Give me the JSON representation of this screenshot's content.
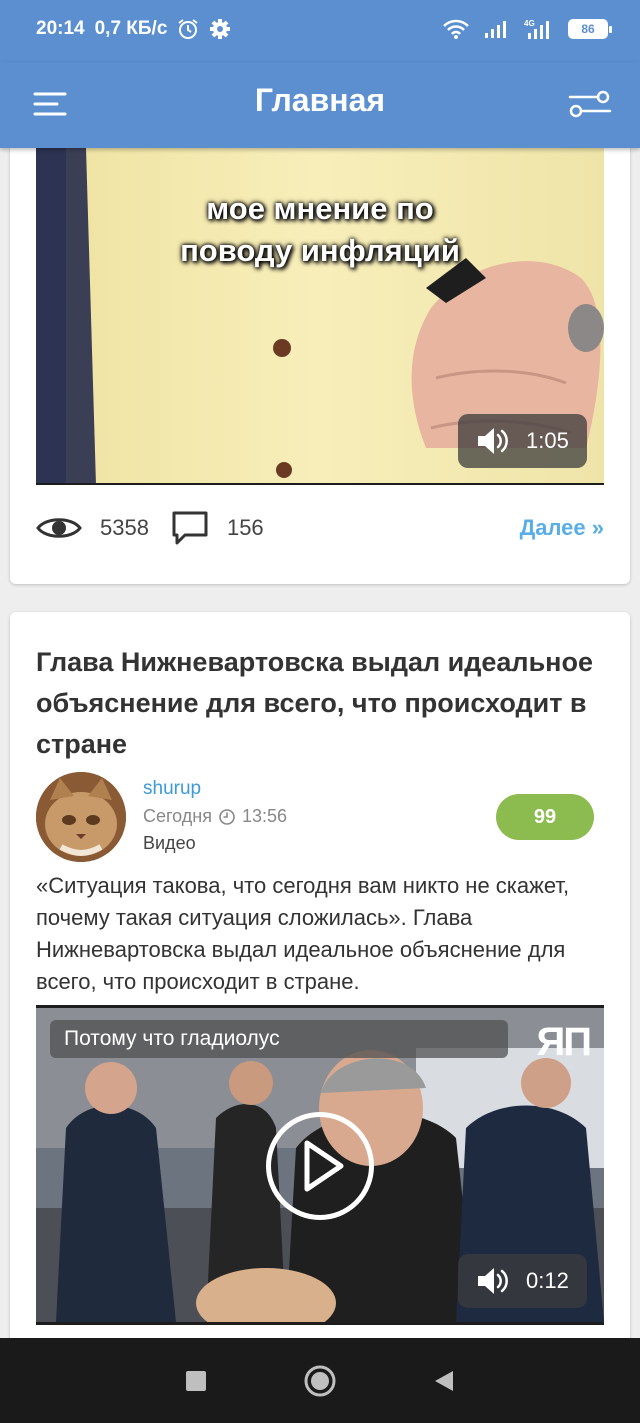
{
  "status_bar": {
    "time": "20:14",
    "speed": "0,7 КБ/с",
    "battery": "86",
    "network": "4G"
  },
  "app_bar": {
    "title": "Главная",
    "menu_icon": "menu-icon",
    "filter_icon": "filter-icon"
  },
  "post1": {
    "video_caption_line1": "мое мнение по",
    "video_caption_line2": "поводу инфляций",
    "duration": "1:05",
    "views": "5358",
    "comments": "156",
    "more_label": "Далее »"
  },
  "post2": {
    "title": "Глава Нижневартовска выдал идеальное объяснение для всего, что происходит в стране",
    "author": "shurup",
    "date_label": "Сегодня",
    "time": "13:56",
    "type": "Видео",
    "rating": "99",
    "description": "«Ситуация такова, что сегодня вам никто не скажет, почему такая ситуация сложилась». Глава Нижневартовска выдал идеальное объяснение для всего, что происходит в стране.",
    "video_caption": "Потому что гладиолус",
    "watermark": "ЯП",
    "duration": "0:12"
  },
  "colors": {
    "primary": "#5b8fd0",
    "link": "#3d9ad6",
    "rating": "#8cbc4f",
    "more": "#5aaee8"
  }
}
